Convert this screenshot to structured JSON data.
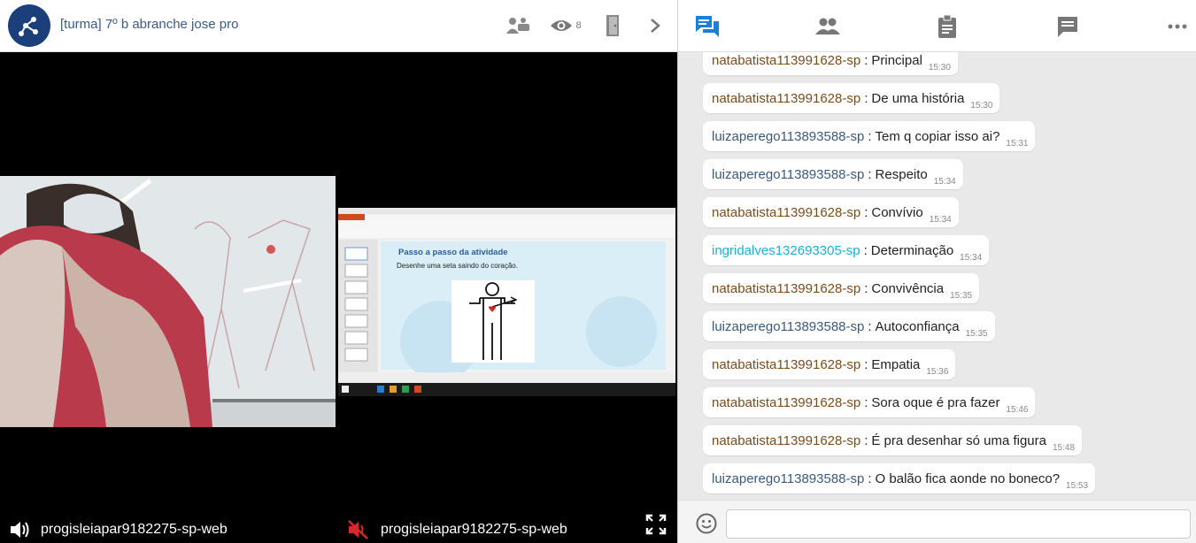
{
  "header": {
    "room_title": "[turma] 7º b abranche jose pro",
    "viewer_count": "8",
    "icons": [
      "logo-icon",
      "participants-on-stage-icon",
      "eye-icon",
      "exit-door-icon",
      "chevron-right-icon"
    ]
  },
  "videos": [
    {
      "name": "progisleiapar9182275-sp-web",
      "audio": "on"
    },
    {
      "name": "progisleiapar9182275-sp-web",
      "audio": "muted"
    }
  ],
  "slide": {
    "title": "Passo a passo da atividade",
    "text": "Desenhe uma seta saindo do coração."
  },
  "tabs": [
    "chat-icon",
    "users-icon",
    "clipboard-icon",
    "message-icon",
    "more-icon"
  ],
  "colors": {
    "accent": "#1a7fd6",
    "brown_author": "#7a4c1c",
    "blue_author": "#3a5a7a",
    "cyan_author": "#1ab0d6"
  },
  "chat": {
    "messages": [
      {
        "author": "natabatista113991628-sp",
        "text": "Principal",
        "time": "15:30",
        "color": "#7a4c1c"
      },
      {
        "author": "natabatista113991628-sp",
        "text": "De uma história",
        "time": "15:30",
        "color": "#7a4c1c"
      },
      {
        "author": "luizaperego113893588-sp",
        "text": "Tem q copiar isso ai?",
        "time": "15:31",
        "color": "#3a5a7a"
      },
      {
        "author": "luizaperego113893588-sp",
        "text": "Respeito",
        "time": "15:34",
        "color": "#3a5a7a"
      },
      {
        "author": "natabatista113991628-sp",
        "text": "Convívio",
        "time": "15:34",
        "color": "#7a4c1c"
      },
      {
        "author": "ingridalves132693305-sp",
        "text": "Determinação",
        "time": "15:34",
        "color": "#1ab0d6"
      },
      {
        "author": "natabatista113991628-sp",
        "text": "Convivência",
        "time": "15:35",
        "color": "#7a4c1c"
      },
      {
        "author": "luizaperego113893588-sp",
        "text": "Autoconfiança",
        "time": "15:35",
        "color": "#3a5a7a"
      },
      {
        "author": "natabatista113991628-sp",
        "text": "Empatia",
        "time": "15:36",
        "color": "#7a4c1c"
      },
      {
        "author": "natabatista113991628-sp",
        "text": "Sora oque é pra fazer",
        "time": "15:46",
        "color": "#7a4c1c"
      },
      {
        "author": "natabatista113991628-sp",
        "text": "É pra desenhar só uma figura",
        "time": "15:48",
        "color": "#7a4c1c"
      },
      {
        "author": "luizaperego113893588-sp",
        "text": "O balão fica aonde no boneco?",
        "time": "15:53",
        "color": "#3a5a7a"
      }
    ],
    "input_value": ""
  }
}
